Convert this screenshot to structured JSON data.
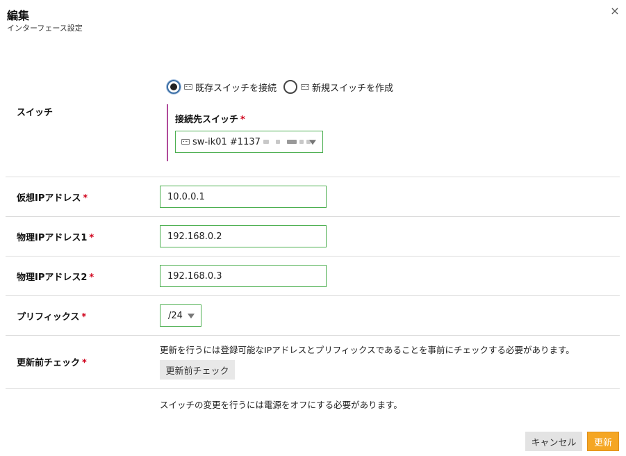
{
  "header": {
    "title": "編集",
    "subtitle": "インターフェース設定",
    "close_glyph": "×"
  },
  "switch_section": {
    "label": "スイッチ",
    "options": [
      {
        "label": "既存スイッチを接続",
        "selected": true
      },
      {
        "label": "新規スイッチを作成",
        "selected": false
      }
    ],
    "target_label": "接続先スイッチ",
    "target_value": "sw-ik01 #1137"
  },
  "virtual_ip": {
    "label": "仮想IPアドレス",
    "value": "10.0.0.1"
  },
  "physical_ip1": {
    "label": "物理IPアドレス1",
    "value": "192.168.0.2"
  },
  "physical_ip2": {
    "label": "物理IPアドレス2",
    "value": "192.168.0.3"
  },
  "prefix": {
    "label": "プリフィックス",
    "value": "/24"
  },
  "pre_check": {
    "label": "更新前チェック",
    "description": "更新を行うには登録可能なIPアドレスとプリフィックスであることを事前にチェックする必要があります。",
    "button": "更新前チェック"
  },
  "note": "スイッチの変更を行うには電源をオフにする必要があります。",
  "footer": {
    "cancel": "キャンセル",
    "submit": "更新"
  },
  "required_mark": "*",
  "colors": {
    "accent": "#f5a623",
    "valid_border": "#4caf50",
    "required": "#d0021b",
    "panel_bar": "#b04a9a"
  }
}
